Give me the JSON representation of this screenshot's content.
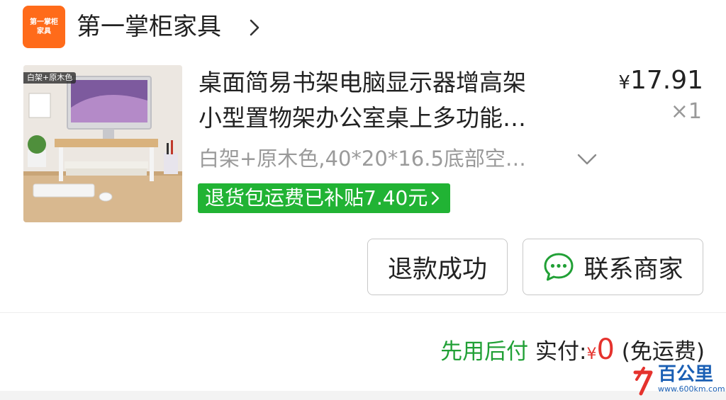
{
  "shop": {
    "logo_line1": "第一掌柜",
    "logo_line2": "家具",
    "name": "第一掌柜家具"
  },
  "product": {
    "image_tag": "白架+原木色",
    "title_line1": "桌面简易书架电脑显示器增高架",
    "title_line2": "小型置物架办公室桌上多功能…",
    "price_symbol": "¥",
    "price_value": "17.91",
    "quantity": "×1",
    "sku": "白架+原木色,40*20*16.5底部空…",
    "subsidy": "退货包运费已补贴7.40元"
  },
  "actions": {
    "refund_label": "退款成功",
    "contact_label": "联系商家"
  },
  "summary": {
    "pay_later": "先用后付",
    "paid_label": "实付:",
    "yen": "¥",
    "amount": "0",
    "shipping_note": "(免运费)"
  },
  "watermark": {
    "text": "百公里",
    "url": "www.600km.com"
  },
  "colors": {
    "brand_orange": "#ff6b1a",
    "subsidy_green": "#21b334",
    "pay_later_green": "#21a036",
    "amount_red": "#e5322d"
  }
}
